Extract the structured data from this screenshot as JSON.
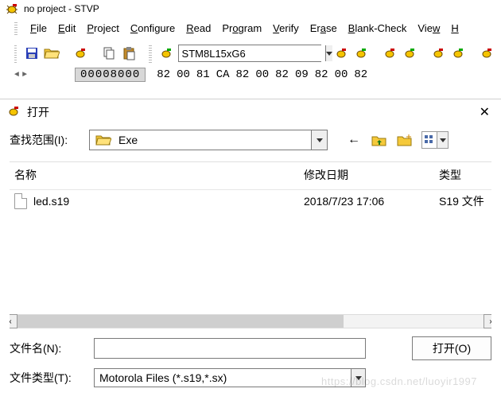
{
  "app": {
    "title": "no project - STVP"
  },
  "menu": {
    "file": "File",
    "edit": "Edit",
    "project": "Project",
    "configure": "Configure",
    "read": "Read",
    "program": "Program",
    "verify": "Verify",
    "erase": "Erase",
    "blank": "Blank-Check",
    "view": "View",
    "help": "H"
  },
  "toolbar": {
    "device": "STM8L15xG6"
  },
  "hexrow": {
    "offset": "00008000",
    "bytes": [
      "82",
      "00",
      "81",
      "CA",
      "82",
      "00",
      "82",
      "09",
      "82",
      "00",
      "82"
    ]
  },
  "dialog": {
    "title": "打开",
    "lookin_label": "查找范围(I):",
    "folder": "Exe",
    "columns": {
      "name": "名称",
      "date": "修改日期",
      "type": "类型"
    },
    "files": [
      {
        "name": "led.s19",
        "date": "2018/7/23 17:06",
        "type": "S19 文件"
      }
    ],
    "filename_label": "文件名(N):",
    "filename_value": "",
    "filetype_label": "文件类型(T):",
    "filetype_value": "Motorola Files (*.s19,*.sx)",
    "open_button": "打开(O)"
  },
  "watermark": "https://blog.csdn.net/luoyir1997"
}
